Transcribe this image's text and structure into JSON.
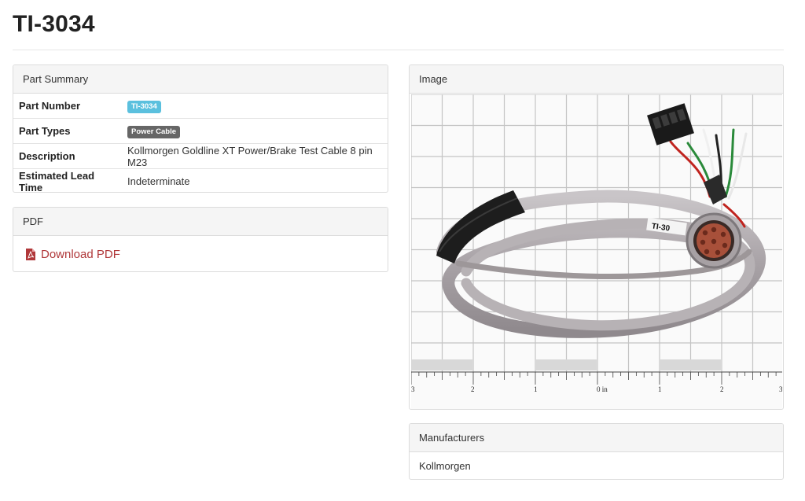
{
  "page": {
    "title": "TI-3034"
  },
  "summary": {
    "heading": "Part Summary",
    "rows": [
      {
        "key": "Part Number",
        "value": "TI-3034"
      },
      {
        "key": "Part Types",
        "value": "Power Cable"
      },
      {
        "key": "Description",
        "value": "Kollmorgen Goldline XT Power/Brake Test Cable 8 pin M23"
      },
      {
        "key": "Estimated Lead Time",
        "value": "Indeterminate"
      }
    ]
  },
  "pdf": {
    "heading": "PDF",
    "link_label": "Download PDF",
    "icon": "pdf-file-icon"
  },
  "image": {
    "heading": "Image",
    "ruler_labels": [
      "3",
      "2",
      "1",
      "0 in",
      "1",
      "2",
      "3"
    ],
    "cable_label": "TI-30"
  },
  "manufacturers": {
    "heading": "Manufacturers",
    "name": "Kollmorgen"
  },
  "colors": {
    "part_number_badge": "#5bc0de",
    "part_type_badge": "#666666",
    "pdf_link": "#b0383a"
  }
}
